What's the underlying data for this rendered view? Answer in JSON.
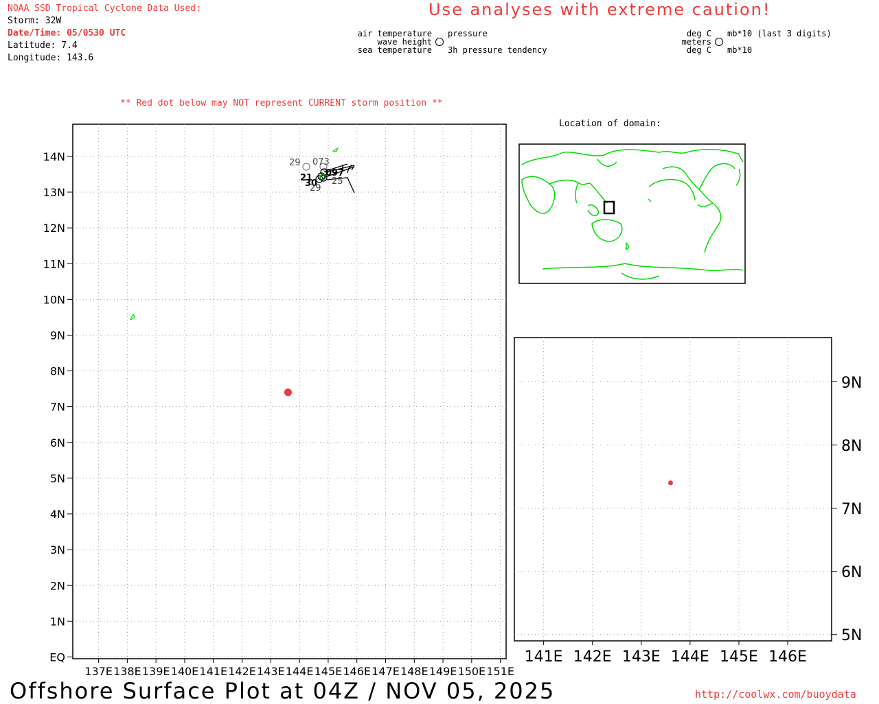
{
  "header": {
    "source": "NOAA SSD Tropical Cyclone Data Used:",
    "storm": "Storm: 32W",
    "datetime": "Date/Time: 05/0530 UTC",
    "latitude": "Latitude: 7.4",
    "longitude": "Longitude: 143.6",
    "caution": "Use analyses with extreme caution!"
  },
  "station_key": {
    "air_temperature": "air temperature",
    "wave_height": "wave height",
    "sea_temperature": "sea temperature",
    "pressure": "pressure",
    "pressure_tendency": "3h pressure tendency",
    "deg_c_top": "deg C",
    "meters": "meters",
    "deg_c_bottom": "deg C",
    "mb_last3": "mb*10 (last 3 digits)",
    "mb": "mb*10"
  },
  "note": "** Red dot below may NOT represent CURRENT storm position **",
  "inset_title": "Location of domain:",
  "footer": {
    "title": "Offshore Surface Plot at 04Z / NOV 05, 2025",
    "url": "http://coolwx.com/buoydata"
  },
  "colors": {
    "storm": "#ee3b3b",
    "coast": "#00dd00",
    "accent": "#ee3b3b"
  },
  "chart_data": [
    {
      "type": "scatter",
      "title": "",
      "x_ticks": [
        "137E",
        "138E",
        "139E",
        "140E",
        "141E",
        "142E",
        "143E",
        "144E",
        "145E",
        "146E",
        "147E",
        "148E",
        "149E",
        "150E",
        "151E"
      ],
      "y_ticks": [
        "EQ",
        "1N",
        "2N",
        "3N",
        "4N",
        "5N",
        "6N",
        "7N",
        "8N",
        "9N",
        "10N",
        "11N",
        "12N",
        "13N",
        "14N"
      ],
      "xlim": [
        136.1,
        151.2
      ],
      "ylim": [
        -0.05,
        14.9
      ],
      "grid": true,
      "storm_position": {
        "lon": 143.6,
        "lat": 7.4
      },
      "station_labels": [
        "29",
        "073",
        "21",
        "30",
        "25",
        "29",
        "097"
      ]
    },
    {
      "type": "scatter",
      "title": "",
      "x_ticks": [
        "141E",
        "142E",
        "143E",
        "144E",
        "145E",
        "146E"
      ],
      "y_ticks": [
        "5N",
        "6N",
        "7N",
        "8N",
        "9N"
      ],
      "xlim": [
        140.4,
        146.9
      ],
      "ylim": [
        4.9,
        9.7
      ],
      "grid": true,
      "storm_position": {
        "lon": 143.6,
        "lat": 7.4
      }
    }
  ]
}
